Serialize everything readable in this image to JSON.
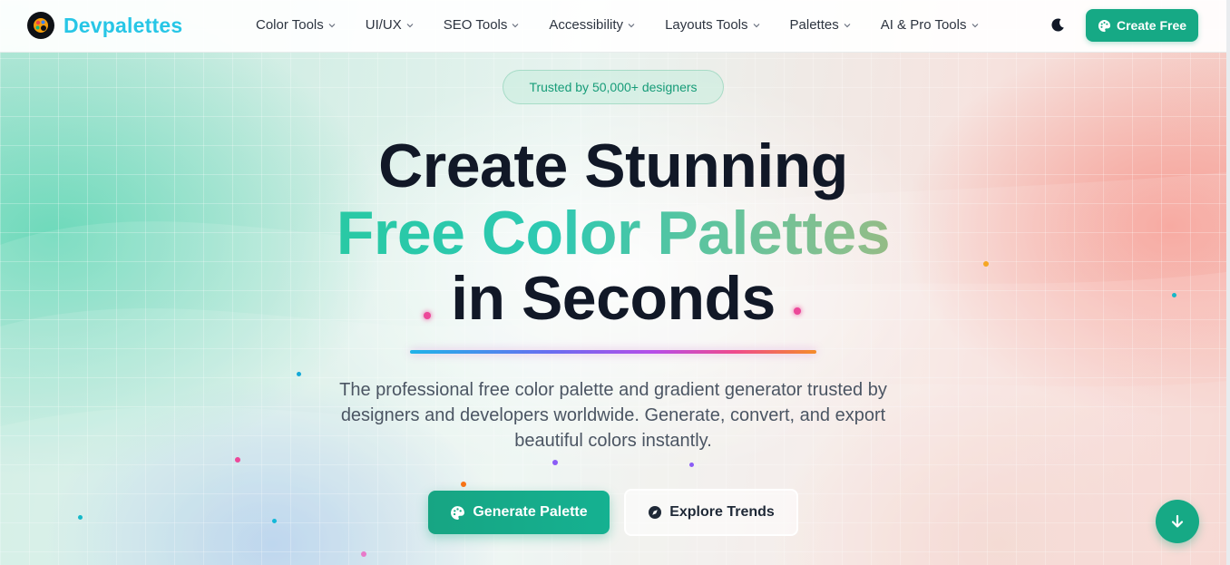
{
  "brand": {
    "name": "Devpalettes",
    "logo_icon": "palette-logo-icon"
  },
  "nav": {
    "items": [
      {
        "label": "Color Tools"
      },
      {
        "label": "UI/UX"
      },
      {
        "label": "SEO Tools"
      },
      {
        "label": "Accessibility"
      },
      {
        "label": "Layouts Tools"
      },
      {
        "label": "Palettes"
      },
      {
        "label": "AI & Pro Tools"
      }
    ],
    "theme_toggle_icon": "moon-icon",
    "cta_label": "Create Free"
  },
  "hero": {
    "badge": "Trusted by 50,000+ designers",
    "headline_line1": "Create Stunning",
    "headline_line2": "Free Color Palettes",
    "headline_line3": "in Seconds",
    "subtitle": "The professional free color palette and gradient generator trusted by designers and developers worldwide. Generate, convert, and export beautiful colors instantly.",
    "primary_button": "Generate Palette",
    "secondary_button": "Explore Trends"
  },
  "colors": {
    "accent": "#16a985",
    "brand_text": "#27c6e6",
    "headline": "#111827"
  }
}
